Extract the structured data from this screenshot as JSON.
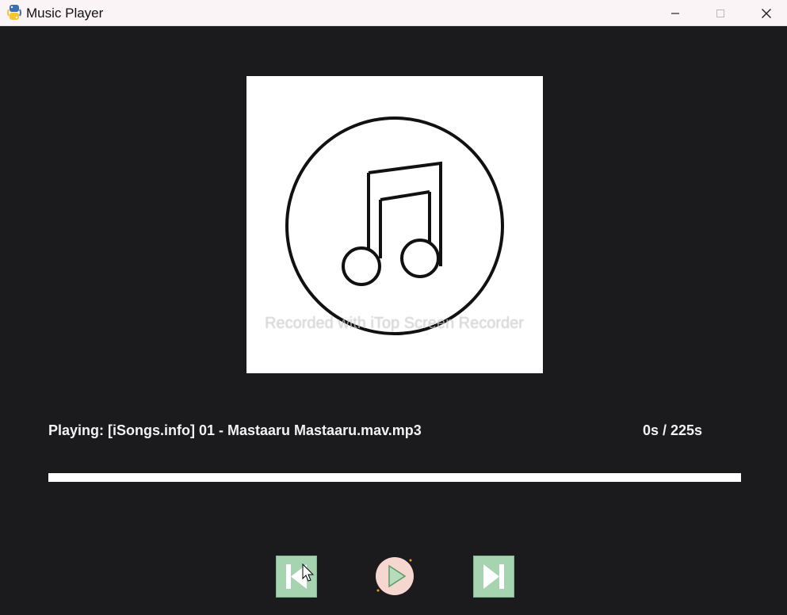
{
  "window": {
    "title": "Music Player",
    "app_icon": "python-icon",
    "controls": [
      "minimize-icon",
      "maximize-icon",
      "close-icon"
    ]
  },
  "album_art": {
    "icon": "music-note-icon"
  },
  "watermark": "Recorded with iTop Screen Recorder",
  "player": {
    "now_playing": "Playing: [iSongs.info] 01 - Mastaaru Mastaaru.mav.mp3",
    "time": "0s / 225s",
    "progress_fraction": 0
  },
  "controls": {
    "previous_icon": "skip-previous-icon",
    "play_icon": "play-icon",
    "next_icon": "skip-next-icon"
  },
  "colors": {
    "background": "#1b1a1c",
    "button_green": "#a6d3b0",
    "play_button": "#f6d7cf"
  }
}
